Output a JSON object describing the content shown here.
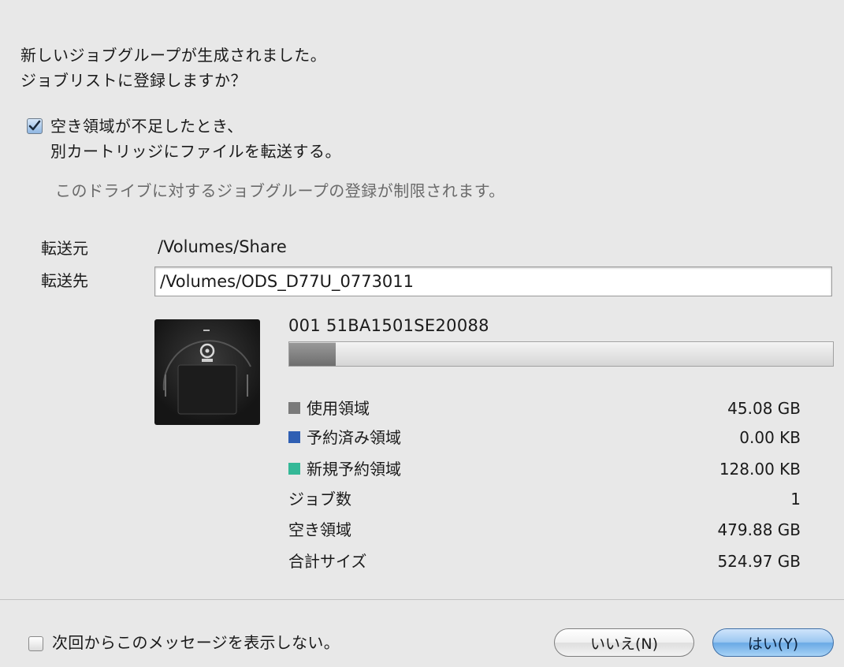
{
  "message": {
    "line1": "新しいジョブグループが生成されました。",
    "line2": "ジョブリストに登録しますか？"
  },
  "option": {
    "checked": true,
    "line1": "空き領域が不足したとき、",
    "line2": "別カートリッジにファイルを転送する。",
    "warning": "このドライブに対するジョブグループの登録が制限されます。"
  },
  "source": {
    "label": "転送元",
    "value": "/Volumes/Share"
  },
  "destination": {
    "label": "転送先",
    "value": "/Volumes/ODS_D77U_0773011"
  },
  "cartridge": {
    "id": "001 51BA1501SE20088",
    "used_fraction": 0.086,
    "image_icon": "optical-disc-cartridge-icon",
    "stats": [
      {
        "label": "使用領域",
        "value": "45.08 GB",
        "swatch": "#7a7a7a"
      },
      {
        "label": "予約済み領域",
        "value": "0.00 KB",
        "swatch": "#2f5fb3"
      },
      {
        "label": "新規予約領域",
        "value": "128.00 KB",
        "swatch": "#34b897"
      },
      {
        "label": "ジョブ数",
        "value": "1"
      },
      {
        "label": "空き領域",
        "value": "479.88 GB"
      },
      {
        "label": "合計サイズ",
        "value": "524.97 GB"
      }
    ]
  },
  "footer": {
    "dont_show_checked": false,
    "dont_show_label": "次回からこのメッセージを表示しない。",
    "no_button": "いいえ(N)",
    "yes_button": "はい(Y)"
  }
}
